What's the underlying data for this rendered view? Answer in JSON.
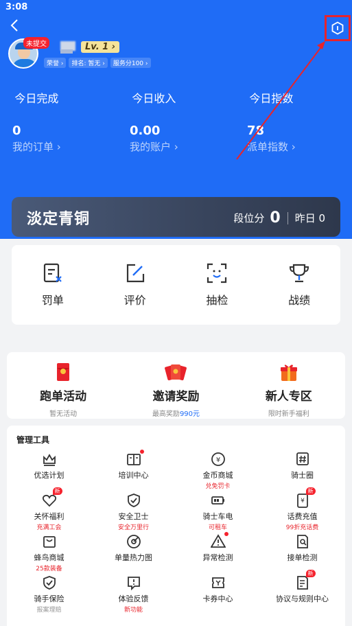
{
  "status_bar": {
    "time": "3:08"
  },
  "profile": {
    "badge": "未提交",
    "level": "Lv. 1",
    "chips": [
      "荣誉",
      "排名: 暂无",
      "服务分100"
    ]
  },
  "stats": [
    {
      "title": "今日完成",
      "value": "0",
      "link": "我的订单"
    },
    {
      "title": "今日收入",
      "value": "0.00",
      "link": "我的账户"
    },
    {
      "title": "今日指数",
      "value": "78",
      "link": "派单指数"
    }
  ],
  "rank": {
    "title": "淡定青铜",
    "score_label": "段位分",
    "score": "0",
    "yesterday": "昨日 0"
  },
  "quick_actions": [
    {
      "label": "罚单",
      "icon": "penalty-icon"
    },
    {
      "label": "评价",
      "icon": "edit-icon"
    },
    {
      "label": "抽检",
      "icon": "scan-face-icon"
    },
    {
      "label": "战绩",
      "icon": "trophy-icon"
    }
  ],
  "promos": [
    {
      "title": "跑单活动",
      "sub": "暂无活动",
      "sub_hl": "",
      "icon": "red-envelope-icon"
    },
    {
      "title": "邀请奖励",
      "sub": "最高奖励",
      "sub_hl": "990元",
      "icon": "red-envelopes-icon"
    },
    {
      "title": "新人专区",
      "sub": "限时新手福利",
      "sub_hl": "",
      "icon": "gift-icon"
    }
  ],
  "tools_header": "管理工具",
  "tools": [
    {
      "name": "优选计划",
      "sub": "",
      "icon": "crown-icon"
    },
    {
      "name": "培训中心",
      "sub": "",
      "icon": "book-icon",
      "dot": true
    },
    {
      "name": "金币商城",
      "sub": "兑免罚卡",
      "icon": "coin-icon"
    },
    {
      "name": "骑士圈",
      "sub": "",
      "icon": "hash-icon"
    },
    {
      "name": "关怀福利",
      "sub": "充满工会",
      "icon": "heart-icon",
      "new": true
    },
    {
      "name": "安全卫士",
      "sub": "安全万里行",
      "icon": "shield-icon"
    },
    {
      "name": "骑士车电",
      "sub": "可租车",
      "icon": "battery-icon"
    },
    {
      "name": "话费充值",
      "sub": "99折充话费",
      "icon": "phone-bill-icon",
      "new": true
    },
    {
      "name": "蜂鸟商城",
      "sub": "25款装备",
      "icon": "shop-icon"
    },
    {
      "name": "单量热力图",
      "sub": "",
      "icon": "target-icon"
    },
    {
      "name": "异常检测",
      "sub": "",
      "icon": "warning-icon",
      "dot": true
    },
    {
      "name": "接单检测",
      "sub": "",
      "icon": "doc-search-icon"
    },
    {
      "name": "骑手保险",
      "sub": "报案理赔",
      "icon": "insurance-icon",
      "gray": true
    },
    {
      "name": "体验反馈",
      "sub": "新功能",
      "icon": "feedback-icon"
    },
    {
      "name": "卡券中心",
      "sub": "",
      "icon": "coupon-icon"
    },
    {
      "name": "协议与规则中心",
      "sub": "",
      "icon": "rules-icon",
      "new": true
    }
  ],
  "new_tag": "新"
}
